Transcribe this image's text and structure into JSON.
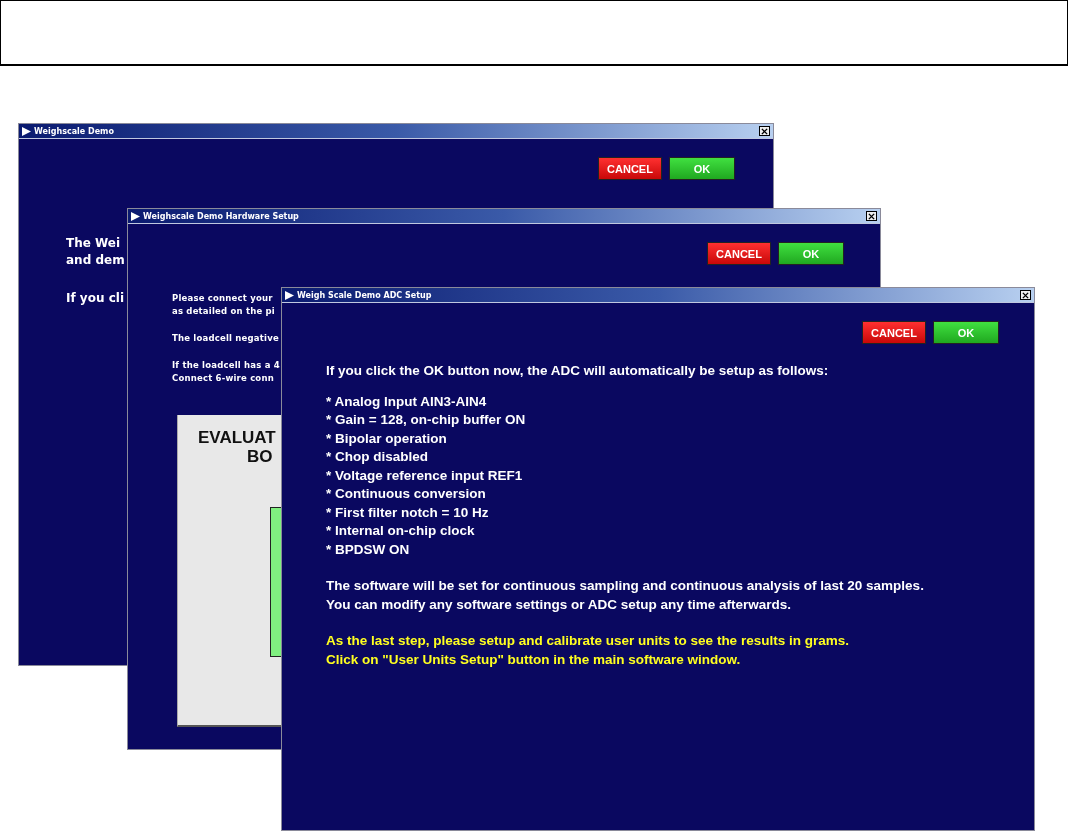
{
  "windows": [
    {
      "title": "Weighscale Demo",
      "buttons": [
        {
          "label": "CANCEL",
          "kind": "cancel"
        },
        {
          "label": "OK",
          "kind": "ok"
        }
      ],
      "blocks": [
        {
          "highlight": false,
          "lines": [
            "The Wei",
            "and dem"
          ]
        },
        {
          "highlight": false,
          "lines": [
            "If you cli"
          ]
        }
      ]
    },
    {
      "title": "Weighscale Demo Hardware Setup",
      "buttons": [
        {
          "label": "CANCEL",
          "kind": "cancel"
        },
        {
          "label": "OK",
          "kind": "ok"
        }
      ],
      "blocks": [
        {
          "highlight": false,
          "lines": [
            "Please connect your",
            "as detailed on the pi"
          ]
        },
        {
          "highlight": false,
          "lines": [
            "The loadcell negative"
          ]
        },
        {
          "highlight": false,
          "lines": [
            "If the loadcell has a 4",
            "Connect 6-wire conn"
          ]
        }
      ],
      "diagram": {
        "lines": [
          "EVALUAT",
          "BO"
        ]
      }
    },
    {
      "title": "Weigh Scale Demo ADC Setup",
      "buttons": [
        {
          "label": "CANCEL",
          "kind": "cancel"
        },
        {
          "label": "OK",
          "kind": "ok"
        }
      ],
      "blocks": [
        {
          "highlight": false,
          "lines": [
            "If you click the OK button now, the ADC will automatically be setup as follows:"
          ]
        },
        {
          "highlight": false,
          "lines": [
            "* Analog Input AIN3-AIN4",
            "* Gain = 128, on-chip buffer ON",
            "* Bipolar operation",
            "* Chop disabled",
            "* Voltage reference input REF1",
            "* Continuous conversion",
            "* First filter notch = 10 Hz",
            "* Internal on-chip clock",
            "* BPDSW ON"
          ]
        },
        {
          "highlight": false,
          "lines": [
            "The software will be set for continuous sampling and continuous analysis of last 20 samples.",
            "You can modify any software settings or ADC setup any time afterwards."
          ]
        },
        {
          "highlight": true,
          "lines": [
            "As the last step, please setup and calibrate user units to see the results in grams.",
            "Click on \"User Units Setup\" button in the main software window."
          ]
        }
      ]
    }
  ]
}
